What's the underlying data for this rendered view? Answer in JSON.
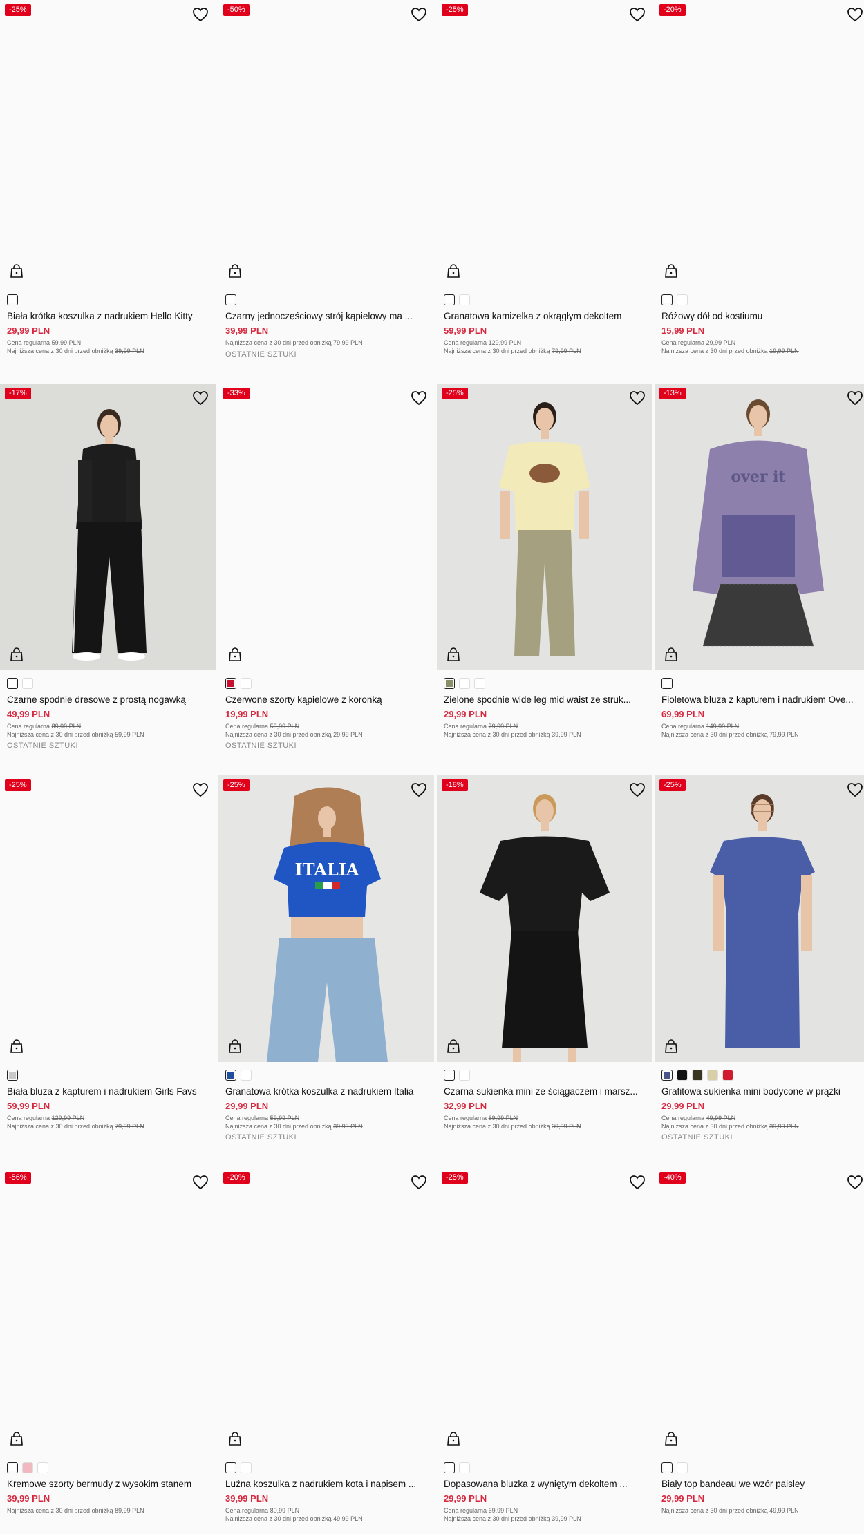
{
  "icons": {
    "wishlist": "heart-outline-icon",
    "add_to_bag": "shopping-bag-icon"
  },
  "colors": {
    "accent_sale": "#e0001b",
    "price_red": "#d6293f"
  },
  "products": [
    {
      "badge": "-25%",
      "title": "Biała krótka koszulka z nadrukiem Hello Kitty",
      "price": "29,99 PLN",
      "regular_label": "Cena regularna",
      "regular_price": "59,99 PLN",
      "lowest_label": "Najniższa cena z 30 dni przed obniżką",
      "lowest_price": "39,99 PLN",
      "last": "",
      "swatches": [
        "#ffffff"
      ],
      "image": false
    },
    {
      "badge": "-50%",
      "title": "Czarny jednoczęściowy strój kąpielowy ma ...",
      "price": "39,99 PLN",
      "regular_label": "",
      "regular_price": "",
      "lowest_label": "Najniższa cena z 30 dni przed obniżką",
      "lowest_price": "79,99 PLN",
      "last": "OSTATNIE SZTUKI",
      "swatches": [
        "#ffffff"
      ],
      "image": false
    },
    {
      "badge": "-25%",
      "title": "Granatowa kamizelka z okrągłym dekoltem",
      "price": "59,99 PLN",
      "regular_label": "Cena regularna",
      "regular_price": "129,99 PLN",
      "lowest_label": "Najniższa cena z 30 dni przed obniżką",
      "lowest_price": "79,99 PLN",
      "last": "",
      "swatches": [
        "#ffffff",
        "#ffffff"
      ],
      "image": false
    },
    {
      "badge": "-20%",
      "title": "Różowy dół od kostiumu",
      "price": "15,99 PLN",
      "regular_label": "Cena regularna",
      "regular_price": "29,99 PLN",
      "lowest_label": "Najniższa cena z 30 dni przed obniżką",
      "lowest_price": "19,99 PLN",
      "last": "",
      "swatches": [
        "#ffffff",
        "#ffffff"
      ],
      "image": false
    },
    {
      "badge": "-17%",
      "title": "Czarne spodnie dresowe z prostą nogawką",
      "price": "49,99 PLN",
      "regular_label": "Cena regularna",
      "regular_price": "89,99 PLN",
      "lowest_label": "Najniższa cena z 30 dni przed obniżką",
      "lowest_price": "59,99 PLN",
      "last": "OSTATNIE SZTUKI",
      "swatches": [
        "#ffffff",
        "#ffffff"
      ],
      "image": true,
      "figure": "vest"
    },
    {
      "badge": "-33%",
      "title": "Czerwone szorty kąpielowe z koronką",
      "price": "19,99 PLN",
      "regular_label": "Cena regularna",
      "regular_price": "59,99 PLN",
      "lowest_label": "Najniższa cena z 30 dni przed obniżką",
      "lowest_price": "29,99 PLN",
      "last": "OSTATNIE SZTUKI",
      "swatches": [
        "#c8102e",
        "#ffffff"
      ],
      "image": false
    },
    {
      "badge": "-25%",
      "title": "Zielone spodnie wide leg mid waist ze struk...",
      "price": "29,99 PLN",
      "regular_label": "Cena regularna",
      "regular_price": "79,99 PLN",
      "lowest_label": "Najniższa cena z 30 dni przed obniżką",
      "lowest_price": "39,99 PLN",
      "last": "",
      "swatches": [
        "#8a8f6a",
        "#ffffff",
        "#ffffff"
      ],
      "image": true,
      "figure": "greenpants"
    },
    {
      "badge": "-13%",
      "title": "Fioletowa bluza z kapturem i nadrukiem Ove...",
      "price": "69,99 PLN",
      "regular_label": "Cena regularna",
      "regular_price": "149,99 PLN",
      "lowest_label": "Najniższa cena z 30 dni przed obniżką",
      "lowest_price": "79,99 PLN",
      "last": "",
      "swatches": [
        "#ffffff"
      ],
      "image": true,
      "figure": "hoodie"
    },
    {
      "badge": "-25%",
      "title": "Biała bluza z kapturem i nadrukiem Girls Favs",
      "price": "59,99 PLN",
      "regular_label": "Cena regularna",
      "regular_price": "129,99 PLN",
      "lowest_label": "Najniższa cena z 30 dni przed obniżką",
      "lowest_price": "79,99 PLN",
      "last": "",
      "swatches": [
        "#c9c9c9"
      ],
      "image": false
    },
    {
      "badge": "-25%",
      "title": "Granatowa krótka koszulka z nadrukiem Italia",
      "price": "29,99 PLN",
      "regular_label": "Cena regularna",
      "regular_price": "59,99 PLN",
      "lowest_label": "Najniższa cena z 30 dni przed obniżką",
      "lowest_price": "39,99 PLN",
      "last": "OSTATNIE SZTUKI",
      "swatches": [
        "#1f4e9c",
        "#ffffff"
      ],
      "image": true,
      "figure": "italia",
      "print_text": "ITALIA"
    },
    {
      "badge": "-18%",
      "title": "Czarna sukienka mini ze ściągaczem i marsz...",
      "price": "32,99 PLN",
      "regular_label": "Cena regularna",
      "regular_price": "69,99 PLN",
      "lowest_label": "Najniższa cena z 30 dni przed obniżką",
      "lowest_price": "39,99 PLN",
      "last": "",
      "swatches": [
        "#ffffff",
        "#ffffff"
      ],
      "image": true,
      "figure": "blackdress"
    },
    {
      "badge": "-25%",
      "title": "Grafitowa sukienka mini bodycone w prążki",
      "price": "29,99 PLN",
      "regular_label": "Cena regularna",
      "regular_price": "49,99 PLN",
      "lowest_label": "Najniższa cena z 30 dni przed obniżką",
      "lowest_price": "39,99 PLN",
      "last": "OSTATNIE SZTUKI",
      "swatches": [
        "#4a5488",
        "#111111",
        "#3a3520",
        "#d8cfa8",
        "#d01a2e"
      ],
      "image": true,
      "figure": "bluedress"
    },
    {
      "badge": "-56%",
      "title": "Kremowe szorty bermudy z wysokim stanem",
      "price": "39,99 PLN",
      "regular_label": "",
      "regular_price": "",
      "lowest_label": "Najniższa cena z 30 dni przed obniżką",
      "lowest_price": "89,99 PLN",
      "last": "",
      "swatches": [
        "#ffffff",
        "#f2b8c0",
        "#ffffff"
      ],
      "image": false
    },
    {
      "badge": "-20%",
      "title": "Luźna koszulka z nadrukiem kota i napisem ...",
      "price": "39,99 PLN",
      "regular_label": "Cena regularna",
      "regular_price": "80,99 PLN",
      "lowest_label": "Najniższa cena z 30 dni przed obniżką",
      "lowest_price": "49,99 PLN",
      "last": "",
      "swatches": [
        "#ffffff",
        "#ffffff"
      ],
      "image": false
    },
    {
      "badge": "-25%",
      "title": "Dopasowana bluzka z wyniętym dekoltem ...",
      "price": "29,99 PLN",
      "regular_label": "Cena regularna",
      "regular_price": "69,99 PLN",
      "lowest_label": "Najniższa cena z 30 dni przed obniżką",
      "lowest_price": "39,99 PLN",
      "last": "",
      "swatches": [
        "#ffffff",
        "#ffffff"
      ],
      "image": false
    },
    {
      "badge": "-40%",
      "title": "Biały top bandeau we wzór paisley",
      "price": "29,99 PLN",
      "regular_label": "",
      "regular_price": "",
      "lowest_label": "Najniższa cena z 30 dni przed obniżką",
      "lowest_price": "49,99 PLN",
      "last": "",
      "swatches": [
        "#ffffff",
        "#ffffff"
      ],
      "image": false
    }
  ]
}
